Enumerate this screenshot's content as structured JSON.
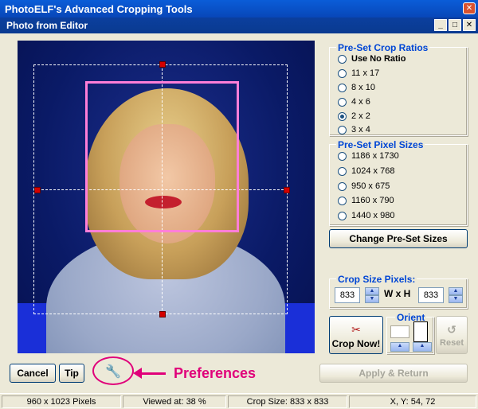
{
  "window": {
    "title": "PhotoELF's Advanced Cropping Tools",
    "close_glyph": "✕"
  },
  "subwindow": {
    "title": "Photo from Editor",
    "min_glyph": "_",
    "max_glyph": "□",
    "close_glyph": "✕"
  },
  "preset_ratios": {
    "title": "Pre-Set Crop Ratios",
    "options": [
      {
        "label": "Use No Ratio",
        "selected": false
      },
      {
        "label": "11 x 17",
        "selected": false
      },
      {
        "label": "8 x 10",
        "selected": false
      },
      {
        "label": "4 x 6",
        "selected": false
      },
      {
        "label": "2 x 2",
        "selected": true
      },
      {
        "label": "3 x 4",
        "selected": false
      }
    ]
  },
  "preset_sizes": {
    "title": "Pre-Set Pixel Sizes",
    "options": [
      {
        "label": "1186 x 1730"
      },
      {
        "label": "1024 x 768"
      },
      {
        "label": "950 x 675"
      },
      {
        "label": "1160 x 790"
      },
      {
        "label": "1440 x 980"
      }
    ],
    "change_button": "Change Pre-Set Sizes"
  },
  "crop_size": {
    "title": "Crop Size Pixels:",
    "width": "833",
    "height": "833",
    "separator": "W x H"
  },
  "actions": {
    "crop_now": "Crop Now!",
    "orient_title": "Orient",
    "reset": "Reset",
    "cancel": "Cancel",
    "tip": "Tip",
    "apply_return": "Apply & Return",
    "preferences_callout": "Preferences"
  },
  "colors": {
    "accent": "#0046D5",
    "callout": "#E0007A",
    "crop_box": "#FF7ED8"
  },
  "status": {
    "dimensions": "960 x 1023 Pixels",
    "viewed_at": "Viewed at: 38 %",
    "crop_size": "Crop Size: 833 x 833",
    "coords": "X, Y: 54, 72"
  }
}
